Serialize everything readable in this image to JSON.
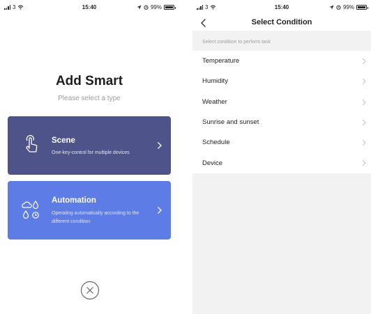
{
  "left_screen": {
    "status": {
      "carrier": "3",
      "time": "15:40",
      "battery": "99%"
    },
    "title": "Add Smart",
    "subtitle": "Please select a type",
    "cards": [
      {
        "title": "Scene",
        "description": "One-key-control for multiple devices",
        "icon": "hand-tap-icon",
        "color": "#4e5489"
      },
      {
        "title": "Automation",
        "description": "Operating automatically according to the different condition",
        "icon": "weather-clock-icon",
        "color": "#5d7ce5"
      }
    ],
    "close_icon": "close-circle-icon"
  },
  "right_screen": {
    "status": {
      "carrier": "3",
      "time": "15:40",
      "battery": "99%"
    },
    "nav": {
      "title": "Select Condition",
      "back_icon": "chevron-left-icon"
    },
    "section_header": "Select condition to perform task",
    "conditions": [
      {
        "label": "Temperature"
      },
      {
        "label": "Humidity"
      },
      {
        "label": "Weather"
      },
      {
        "label": "Sunrise and sunset"
      },
      {
        "label": "Schedule"
      },
      {
        "label": "Device"
      }
    ]
  }
}
